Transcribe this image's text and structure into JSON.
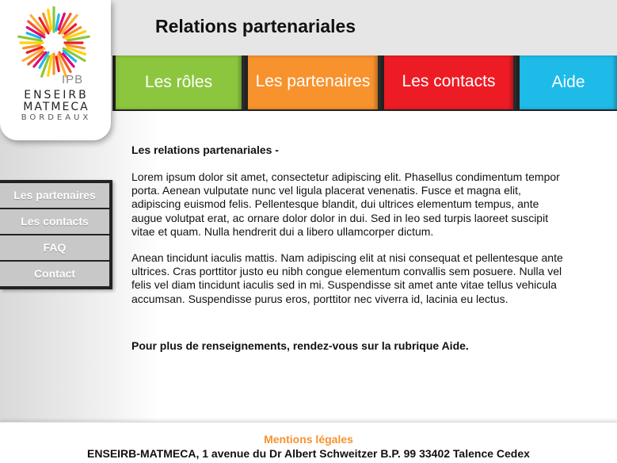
{
  "header": {
    "title": "Relations partenariales"
  },
  "logo": {
    "ipb": "IPB",
    "line1": "ENSEIRB",
    "line2": "MATMECA",
    "line3": "BORDEAUX"
  },
  "colors": {
    "roles": "#8cc63f",
    "partners": "#f7922d",
    "contacts": "#ed1c24",
    "aide": "#1ebbe8",
    "footer_link": "#f7922d"
  },
  "topnav": {
    "roles": "Les rôles",
    "partners": "Les partenaires",
    "contacts": "Les contacts",
    "aide": "Aide"
  },
  "sidemenu": {
    "items": [
      "Les partenaires",
      "Les contacts",
      "FAQ",
      "Contact"
    ]
  },
  "content": {
    "heading": "Les relations partenariales -",
    "para1": "Lorem ipsum dolor sit amet, consectetur adipiscing elit. Phasellus condimentum tempor porta. Aenean vulputate nunc vel ligula placerat venenatis. Fusce et magna elit, adipiscing euismod felis. Pellentesque blandit, dui ultrices elementum tempus, ante augue volutpat erat, ac ornare dolor dolor in dui. Sed in leo sed turpis laoreet suscipit vitae et quam. Nulla hendrerit dui a libero ullamcorper dictum.",
    "para2": "Anean tincidunt iaculis mattis. Nam adipiscing elit at nisi consequat et pellentesque ante ultrices. Cras porttitor justo eu nibh congue elementum convallis sem posuere. Nulla vel felis vel diam tincidunt iaculis sed in mi. Suspendisse sit amet ante vitae tellus vehicula accumsan. Suspendisse purus eros, porttitor nec viverra id, lacinia eu lectus.",
    "more": "Pour plus de renseignements, rendez-vous sur la rubrique Aide."
  },
  "footer": {
    "legal": "Mentions légales",
    "address": "ENSEIRB-MATMECA, 1 avenue du Dr Albert Schweitzer B.P. 99 33402 Talence Cedex"
  }
}
